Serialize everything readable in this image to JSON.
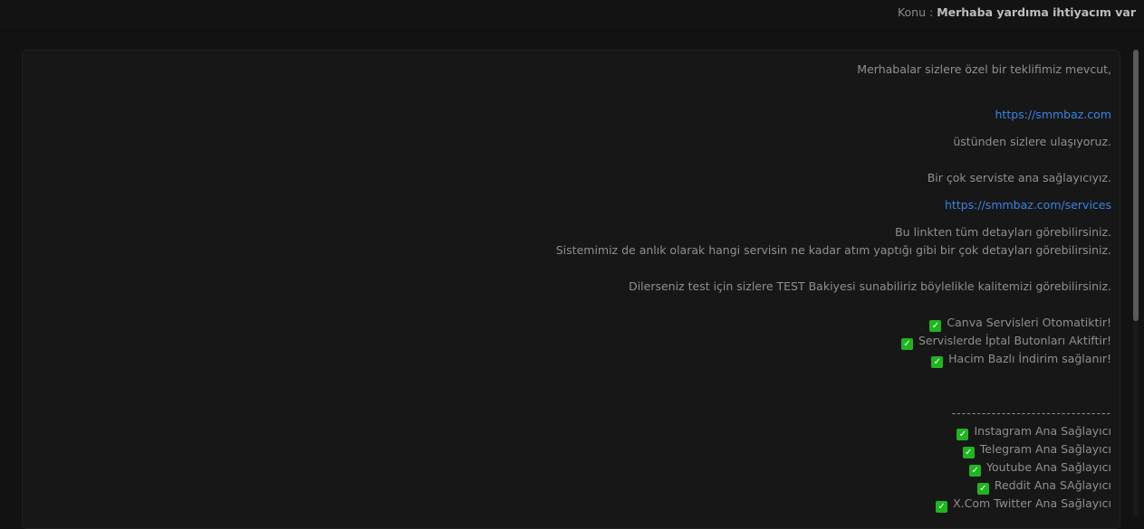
{
  "header": {
    "subject_label": "Konu :",
    "subject_value": "Merhaba yardıma ihtiyacım var"
  },
  "message": {
    "greeting": "Merhabalar sizlere özel bir teklifimiz mevcut,",
    "link1": "https://smmbaz.com",
    "line_reach": "üstünden sizlere ulaşıyoruz.",
    "line_provider": "Bir çok serviste ana sağlayıcıyız.",
    "link2": "https://smmbaz.com/services",
    "line_details": "Bu linkten tüm detayları görebilirsiniz.",
    "line_system": "Sistemimiz de anlık olarak hangi servisin ne kadar atım yaptığı gibi bir çok detayları görebilirsiniz.",
    "line_test": "Dilerseniz test için sizlere TEST Bakiyesi sunabiliriz böylelikle kalitemizi görebilirsiniz.",
    "features": [
      "Canva Servisleri Otomatiktir!",
      "Servislerde İptal Butonları Aktiftir!",
      "Hacim Bazlı İndirim sağlanır!"
    ],
    "divider": "--------------------------------",
    "providers": [
      "Instagram Ana Sağlayıcı",
      "Telegram Ana Sağlayıcı",
      "Youtube Ana Sağlayıcı",
      "Reddit Ana SAğlayıcı",
      "X.Com Twitter Ana Sağlayıcı"
    ]
  },
  "icons": {
    "check": "check-box-icon",
    "check_color": "#22b322",
    "link_color": "#3b82e6"
  }
}
